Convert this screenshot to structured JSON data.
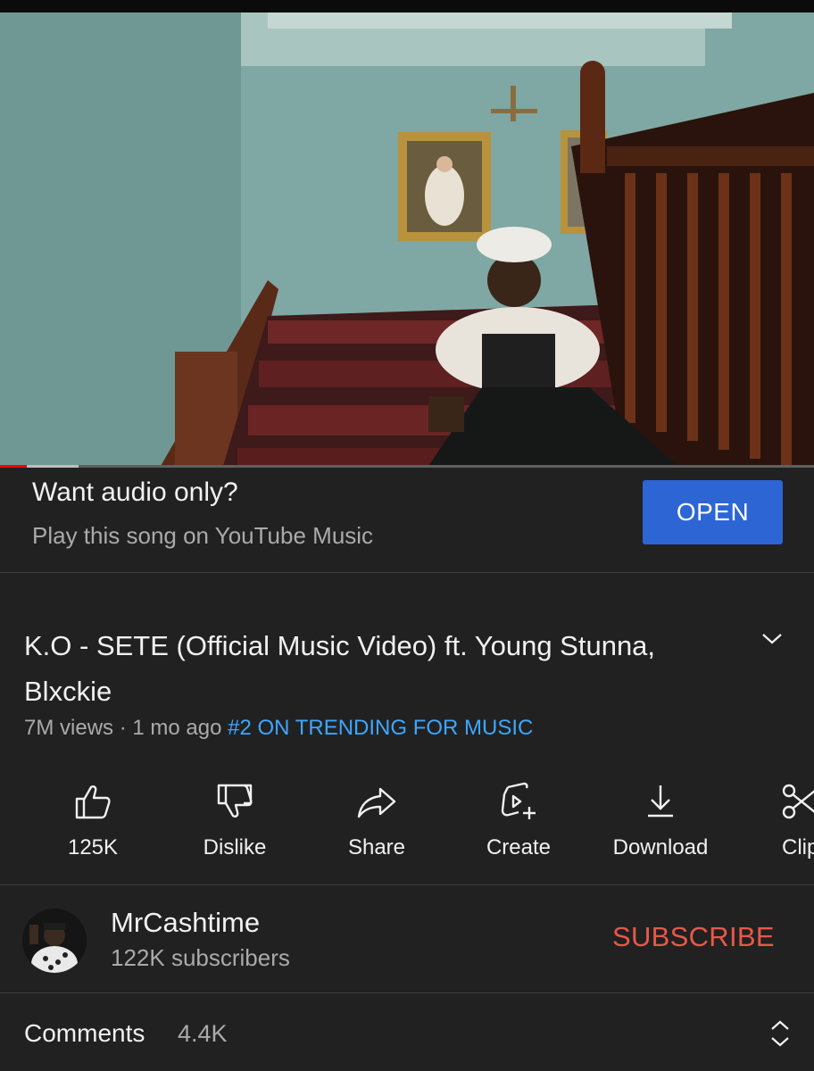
{
  "video": {
    "progress_fraction": 0.033,
    "buffered_fraction": 0.097
  },
  "promo": {
    "title": "Want audio only?",
    "subtitle": "Play this song on YouTube Music",
    "button_label": "OPEN"
  },
  "title": "K.O - SETE (Official Music Video) ft. Young Stunna, Blxckie",
  "meta": {
    "views": "7M views",
    "separator": " · ",
    "age": "1 mo ago",
    "trending": "#2 ON TRENDING FOR MUSIC"
  },
  "actions": [
    {
      "icon": "thumbs-up-icon",
      "label": "125K"
    },
    {
      "icon": "thumbs-down-icon",
      "label": "Dislike"
    },
    {
      "icon": "share-icon",
      "label": "Share"
    },
    {
      "icon": "create-icon",
      "label": "Create"
    },
    {
      "icon": "download-icon",
      "label": "Download"
    },
    {
      "icon": "clip-icon",
      "label": "Clip"
    }
  ],
  "channel": {
    "name": "MrCashtime",
    "subscribers": "122K subscribers",
    "subscribe_label": "SUBSCRIBE"
  },
  "comments": {
    "label": "Comments",
    "count": "4.4K"
  },
  "colors": {
    "background": "#212121",
    "accent_blue": "#2d65d4",
    "trending_blue": "#3ea6ff",
    "subscribe_red": "#e8584a",
    "progress_red": "#ff0000"
  }
}
